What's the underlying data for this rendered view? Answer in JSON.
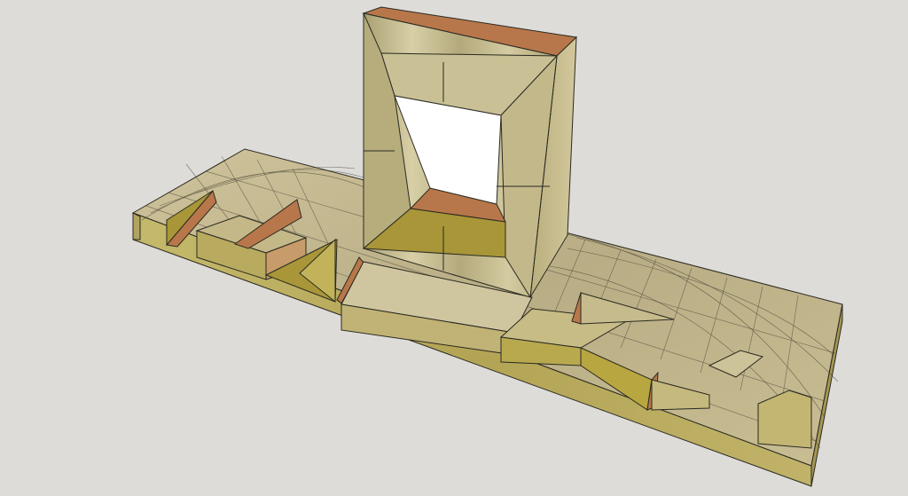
{
  "scene": {
    "description_tag": "3d-model-render",
    "colors": {
      "background": "#dddcd9",
      "top_face": "#c6b98e",
      "side_face": "#b8a964",
      "front_face": "#c4b86e",
      "accent_copper": "#b8774a",
      "accent_olive": "#a89638",
      "frame_face": "#c9bd8e",
      "frame_inner": "#bdb07a",
      "edge": "#2a2a22",
      "hole": "#ffffff"
    }
  }
}
